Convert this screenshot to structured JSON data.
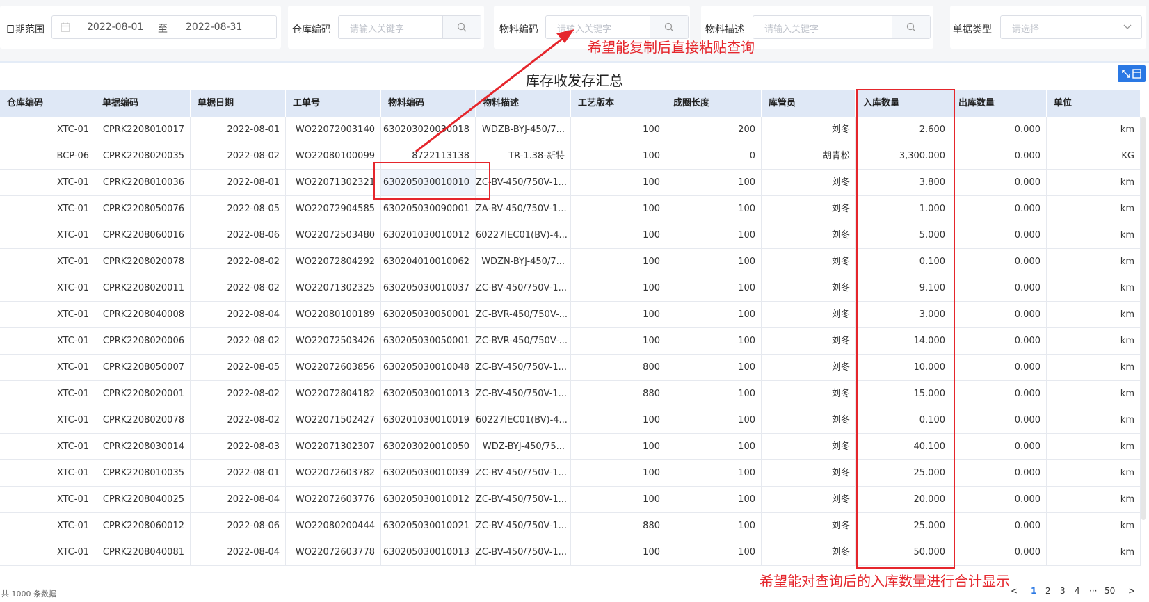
{
  "filters": {
    "date_range": {
      "label": "日期范围",
      "start": "2022-08-01",
      "separator": "至",
      "end": "2022-08-31"
    },
    "warehouse_code": {
      "label": "仓库编码",
      "placeholder": "请输入关键字"
    },
    "material_code": {
      "label": "物料编码",
      "placeholder": "请输入关键字"
    },
    "material_desc": {
      "label": "物料描述",
      "placeholder": "请输入关键字"
    },
    "doc_type": {
      "label": "单据类型",
      "placeholder": "请选择"
    }
  },
  "table": {
    "title": "库存收发存汇总",
    "columns": [
      "仓库编码",
      "单据编码",
      "单据日期",
      "工单号",
      "物料编码",
      "物料描述",
      "工艺版本",
      "成圈长度",
      "库管员",
      "入库数量",
      "出库数量",
      "单位"
    ],
    "rows": [
      [
        "XTC-01",
        "CPRK2208010017",
        "2022-08-01",
        "WO22072003140",
        "630203020030018",
        "WDZB-BYJ-450/7...",
        "100",
        "200",
        "刘冬",
        "2.600",
        "0.000",
        "km"
      ],
      [
        "BCP-06",
        "CPRK2208020035",
        "2022-08-02",
        "WO22080100099",
        "8722113138",
        "TR-1.38-新特",
        "100",
        "0",
        "胡青松",
        "3,300.000",
        "0.000",
        "KG"
      ],
      [
        "XTC-01",
        "CPRK2208010036",
        "2022-08-01",
        "WO22071302321",
        "630205030010010",
        "ZC-BV-450/750V-1...",
        "100",
        "100",
        "刘冬",
        "3.800",
        "0.000",
        "km"
      ],
      [
        "XTC-01",
        "CPRK2208050076",
        "2022-08-05",
        "WO22072904585",
        "630205030090001",
        "ZA-BV-450/750V-1...",
        "100",
        "100",
        "刘冬",
        "1.000",
        "0.000",
        "km"
      ],
      [
        "XTC-01",
        "CPRK2208060016",
        "2022-08-06",
        "WO22072503480",
        "630201030010012",
        "60227IEC01(BV)-4...",
        "100",
        "100",
        "刘冬",
        "5.000",
        "0.000",
        "km"
      ],
      [
        "XTC-01",
        "CPRK2208020078",
        "2022-08-02",
        "WO22072804292",
        "630204010010062",
        "WDZN-BYJ-450/7...",
        "100",
        "100",
        "刘冬",
        "0.100",
        "0.000",
        "km"
      ],
      [
        "XTC-01",
        "CPRK2208020011",
        "2022-08-02",
        "WO22071302325",
        "630205030010037",
        "ZC-BV-450/750V-1...",
        "100",
        "100",
        "刘冬",
        "9.100",
        "0.000",
        "km"
      ],
      [
        "XTC-01",
        "CPRK2208040008",
        "2022-08-04",
        "WO22080100189",
        "630205030050001",
        "ZC-BVR-450/750V-...",
        "100",
        "100",
        "刘冬",
        "3.000",
        "0.000",
        "km"
      ],
      [
        "XTC-01",
        "CPRK2208020006",
        "2022-08-02",
        "WO22072503426",
        "630205030050001",
        "ZC-BVR-450/750V-...",
        "100",
        "100",
        "刘冬",
        "14.000",
        "0.000",
        "km"
      ],
      [
        "XTC-01",
        "CPRK2208050007",
        "2022-08-05",
        "WO22072603856",
        "630205030010048",
        "ZC-BV-450/750V-1...",
        "800",
        "100",
        "刘冬",
        "10.000",
        "0.000",
        "km"
      ],
      [
        "XTC-01",
        "CPRK2208020001",
        "2022-08-02",
        "WO22072804182",
        "630205030010013",
        "ZC-BV-450/750V-1...",
        "880",
        "100",
        "刘冬",
        "15.000",
        "0.000",
        "km"
      ],
      [
        "XTC-01",
        "CPRK2208020078",
        "2022-08-02",
        "WO22071502427",
        "630201030010019",
        "60227IEC01(BV)-4...",
        "100",
        "100",
        "刘冬",
        "0.100",
        "0.000",
        "km"
      ],
      [
        "XTC-01",
        "CPRK2208030014",
        "2022-08-03",
        "WO22071302307",
        "630203020010050",
        "WDZ-BYJ-450/75...",
        "100",
        "100",
        "刘冬",
        "40.100",
        "0.000",
        "km"
      ],
      [
        "XTC-01",
        "CPRK2208010035",
        "2022-08-01",
        "WO22072603782",
        "630205030010039",
        "ZC-BV-450/750V-1...",
        "100",
        "100",
        "刘冬",
        "25.000",
        "0.000",
        "km"
      ],
      [
        "XTC-01",
        "CPRK2208040025",
        "2022-08-04",
        "WO22072603776",
        "630205030010012",
        "ZC-BV-450/750V-1...",
        "100",
        "100",
        "刘冬",
        "20.000",
        "0.000",
        "km"
      ],
      [
        "XTC-01",
        "CPRK2208060012",
        "2022-08-06",
        "WO22080200444",
        "630205030010021",
        "ZC-BV-450/750V-1...",
        "880",
        "100",
        "刘冬",
        "25.000",
        "0.000",
        "km"
      ],
      [
        "XTC-01",
        "CPRK2208040081",
        "2022-08-04",
        "WO22072603778",
        "630205030010013",
        "ZC-BV-450/750V-1...",
        "100",
        "100",
        "刘冬",
        "50.000",
        "0.000",
        "km"
      ]
    ]
  },
  "footer": {
    "total": "共 1000 条数据",
    "pages": [
      "1",
      "2",
      "3",
      "4",
      "···",
      "50"
    ],
    "prev": "<",
    "next": ">"
  },
  "annotations": {
    "top": "希望能复制后直接粘贴查询",
    "bottom": "希望能对查询后的入库数量进行合计显示",
    "color": "#e5262c"
  },
  "colors": {
    "header_bg": "#dfe8f6",
    "accent": "#2a78e4"
  },
  "icons": {
    "date": "calendar-icon",
    "search": "search-icon",
    "select": "chevron-down-icon",
    "fullscreen": "expand-icon"
  }
}
